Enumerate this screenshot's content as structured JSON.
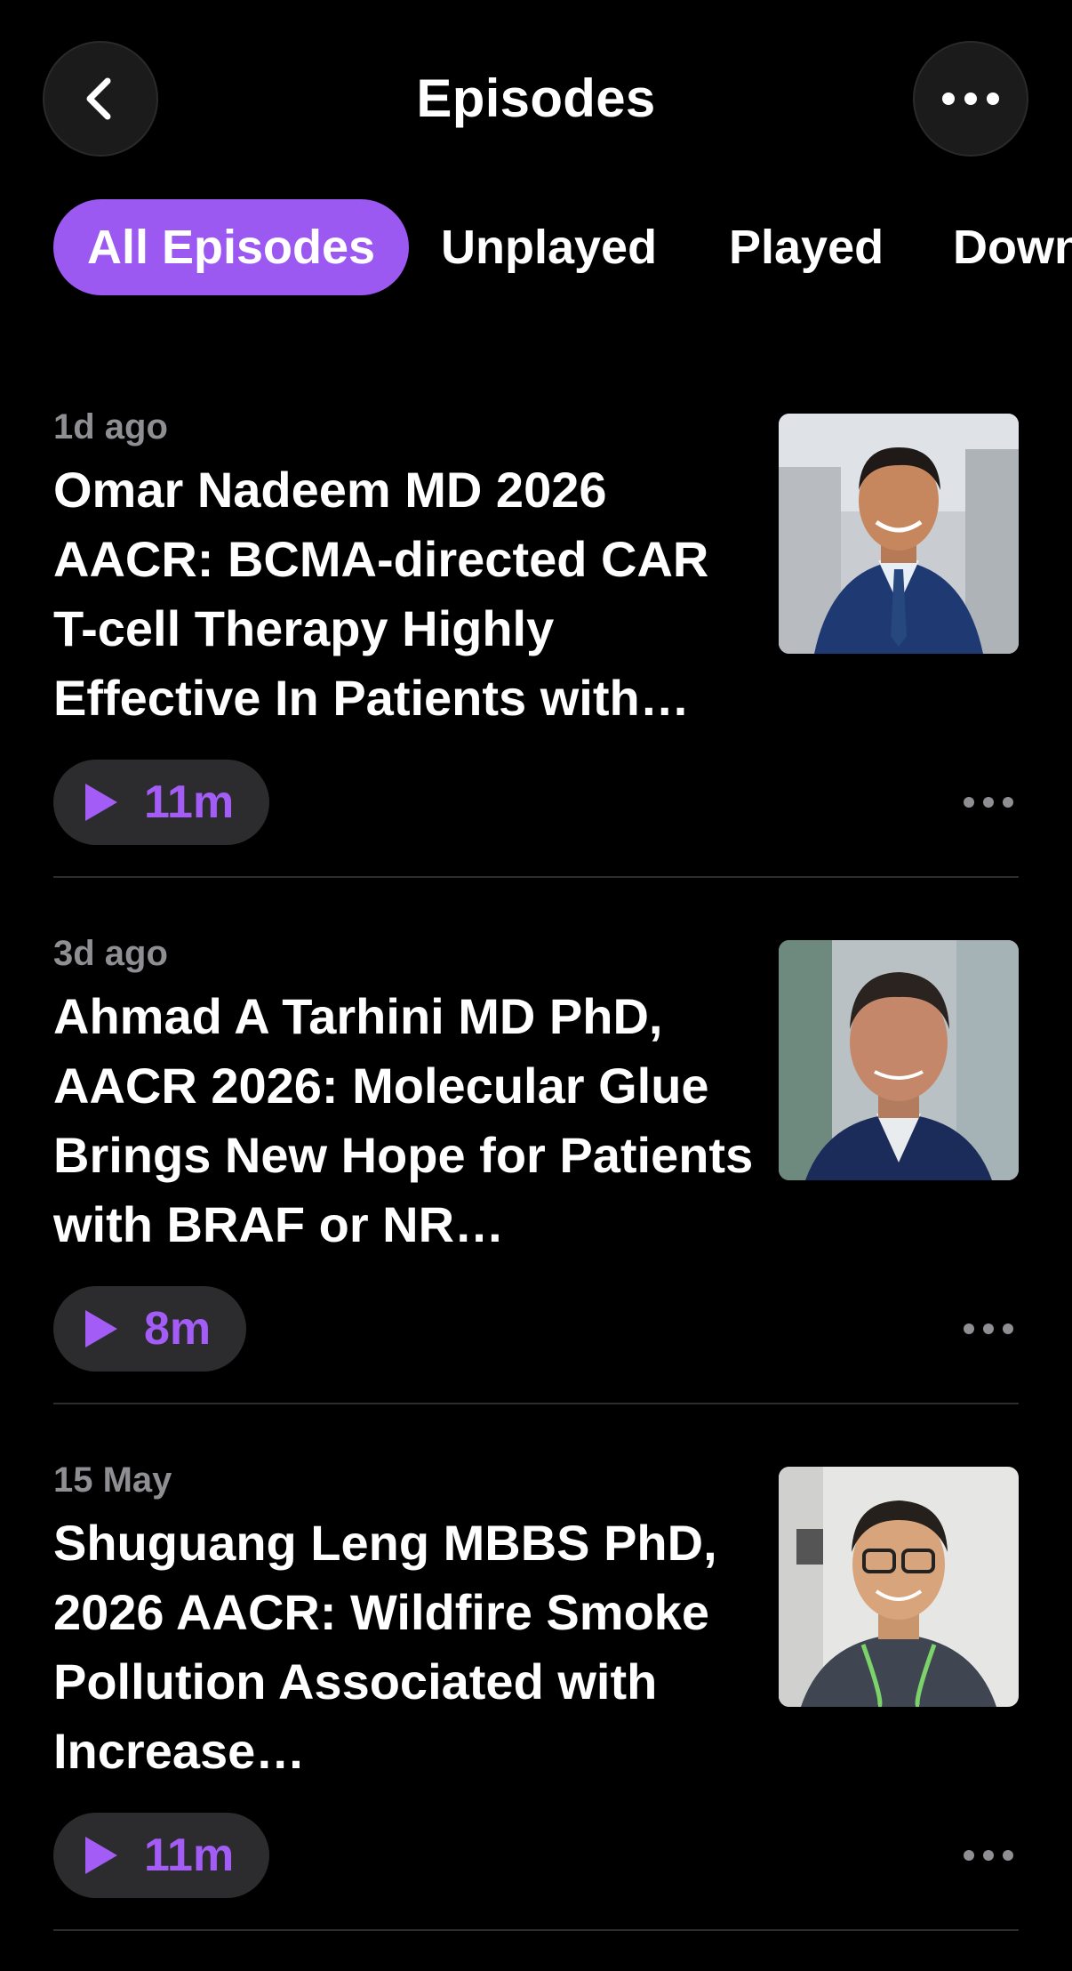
{
  "header": {
    "title": "Episodes",
    "back_icon": "chevron-left-icon",
    "more_icon": "ellipsis-icon"
  },
  "filters": [
    {
      "label": "All Episodes",
      "active": true
    },
    {
      "label": "Unplayed",
      "active": false
    },
    {
      "label": "Played",
      "active": false
    },
    {
      "label": "Downloaded",
      "active": false
    }
  ],
  "episodes": [
    {
      "date": "1d ago",
      "title": "Omar Nadeem MD 2026 AACR: BCMA-directed CAR T-cell Therapy Highly Effective In Patients with…",
      "duration": "11m"
    },
    {
      "date": "3d ago",
      "title": "Ahmad A Tarhini MD PhD, AACR 2026: Molecular Glue Brings New Hope for Patients with BRAF or NR…",
      "duration": "8m"
    },
    {
      "date": "15 May",
      "title": "Shuguang Leng MBBS PhD, 2026 AACR: Wildfire Smoke Pollution Associated with Increase…",
      "duration": "11m"
    }
  ],
  "colors": {
    "accent": "#9b59f2",
    "background": "#000000",
    "pill": "#2c2c2e",
    "secondary_text": "#8e8e93"
  }
}
